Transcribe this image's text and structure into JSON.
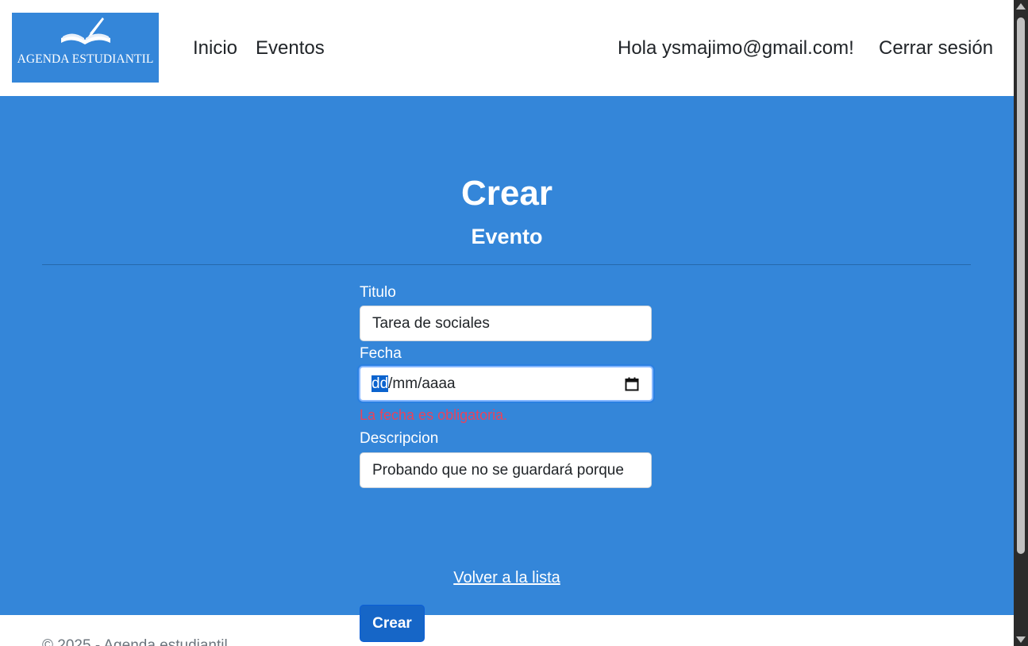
{
  "header": {
    "logo_text": "AGENDA ESTUDIANTIL",
    "nav": {
      "inicio": "Inicio",
      "eventos": "Eventos"
    },
    "greeting": "Hola ysmajimo@gmail.com!",
    "logout": "Cerrar sesión"
  },
  "main": {
    "title": "Crear",
    "subtitle": "Evento",
    "form": {
      "titulo_label": "Titulo",
      "titulo_value": "Tarea de sociales",
      "fecha_label": "Fecha",
      "fecha_day": "dd",
      "fecha_rest": "/mm/aaaa",
      "fecha_error": "La fecha es obligatoria.",
      "descripcion_label": "Descripcion",
      "descripcion_value": "Probando que no se guardará porque",
      "submit_label": "Crear"
    },
    "back_link": "Volver a la lista"
  },
  "footer": {
    "text": "© 2025 - Agenda estudiantil"
  },
  "colors": {
    "brand": "#3486d9",
    "button": "#1666c7",
    "error": "#e8435c"
  },
  "icons": {
    "logo": "open-book-quill-icon",
    "calendar": "calendar-icon"
  }
}
